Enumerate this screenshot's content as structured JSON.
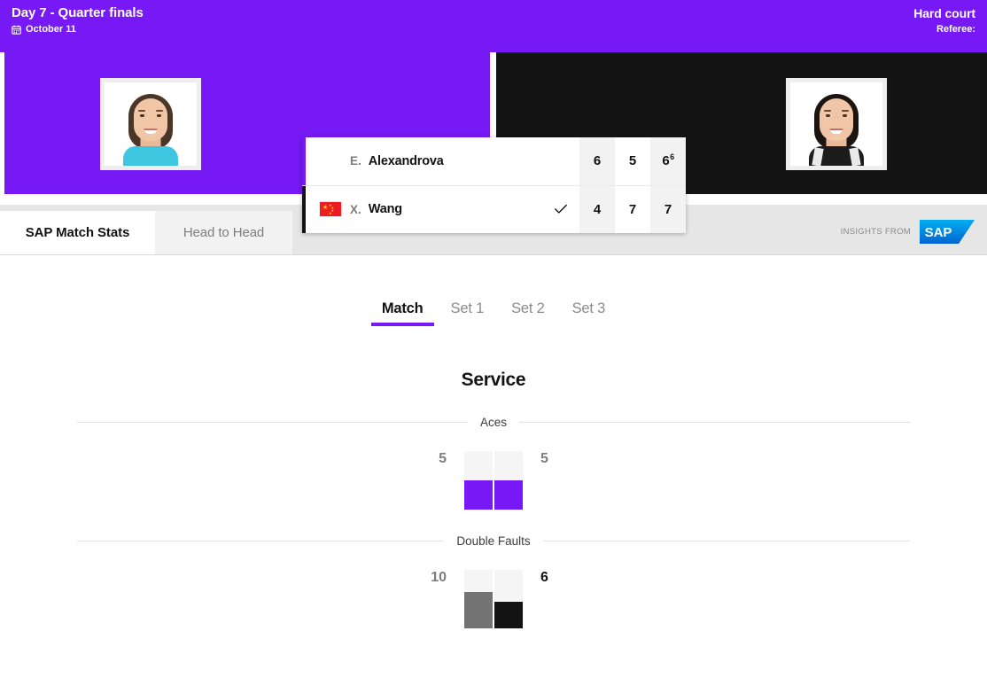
{
  "header": {
    "title": "Day 7 - Quarter finals",
    "date": "October 11",
    "calendar_icon": "calendar-icon",
    "surface": "Hard court",
    "referee": "Referee:",
    "background_color": "#7719f5"
  },
  "banner": {
    "left_panel_color": "#7719f5",
    "right_panel_color": "#131313"
  },
  "scoreboard": {
    "players": [
      {
        "initial": "E.",
        "name": "Alexandrova",
        "flag": "",
        "accent_color": "#7719f5",
        "winner": false,
        "sets": [
          "6",
          "5",
          "6"
        ],
        "tiebreaks": [
          "",
          "",
          "6"
        ]
      },
      {
        "initial": "X.",
        "name": "Wang",
        "flag": "china-flag",
        "accent_color": "#131313",
        "winner": true,
        "winner_mark": "check-icon",
        "sets": [
          "4",
          "7",
          "7"
        ],
        "tiebreaks": [
          "",
          "",
          ""
        ]
      }
    ]
  },
  "tabs": {
    "items": [
      {
        "label": "SAP Match Stats",
        "active": true
      },
      {
        "label": "Head to Head",
        "active": false
      }
    ],
    "insights_label": "INSIGHTS FROM",
    "brand_logo": "sap-logo",
    "brand_color": "#0faaff"
  },
  "set_tabs": {
    "items": [
      {
        "label": "Match",
        "active": true
      },
      {
        "label": "Set 1",
        "active": false
      },
      {
        "label": "Set 2",
        "active": false
      },
      {
        "label": "Set 3",
        "active": false
      }
    ],
    "underline_color": "#7719f5"
  },
  "stats": {
    "section_title": "Service",
    "blocks": [
      {
        "label": "Aces",
        "left": {
          "value": "5",
          "fill_ratio": 0.5,
          "color": "#7719f5",
          "text_color": "dim"
        },
        "right": {
          "value": "5",
          "fill_ratio": 0.5,
          "color": "#7719f5",
          "text_color": "dim"
        }
      },
      {
        "label": "Double Faults",
        "left": {
          "value": "10",
          "fill_ratio": 0.62,
          "color": "#737373",
          "text_color": "dim"
        },
        "right": {
          "value": "6",
          "fill_ratio": 0.46,
          "color": "#131313",
          "text_color": "dark"
        }
      }
    ]
  },
  "chart_data": {
    "type": "bar",
    "title": "Service",
    "categories": [
      "Aces",
      "Double Faults"
    ],
    "series": [
      {
        "name": "E. Alexandrova",
        "values": [
          5,
          10
        ]
      },
      {
        "name": "X. Wang",
        "values": [
          5,
          6
        ]
      }
    ],
    "xlabel": "",
    "ylabel": "",
    "legend": "none",
    "grid": false,
    "orientation": "vertical-paired"
  }
}
